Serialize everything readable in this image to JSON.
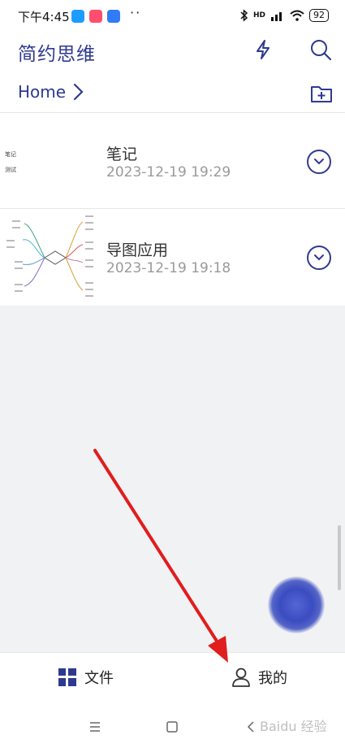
{
  "status_bar": {
    "time": "下午4:45",
    "dots": "··",
    "network": "HD",
    "battery": "92"
  },
  "header": {
    "app_title": "简约思维"
  },
  "breadcrumb": {
    "label": "Home"
  },
  "files": [
    {
      "name": "笔记",
      "date": "2023-12-19 19:29",
      "thumb_lines": [
        "笔记",
        "测试"
      ]
    },
    {
      "name": "导图应用",
      "date": "2023-12-19 19:18"
    }
  ],
  "bottom_nav": {
    "tab_files": "文件",
    "tab_me": "我的"
  },
  "watermark": "Baidu 经验",
  "colors": {
    "accent": "#2f3a8f",
    "arrow": "#e11d1d",
    "fab": "#3a4cc0"
  }
}
